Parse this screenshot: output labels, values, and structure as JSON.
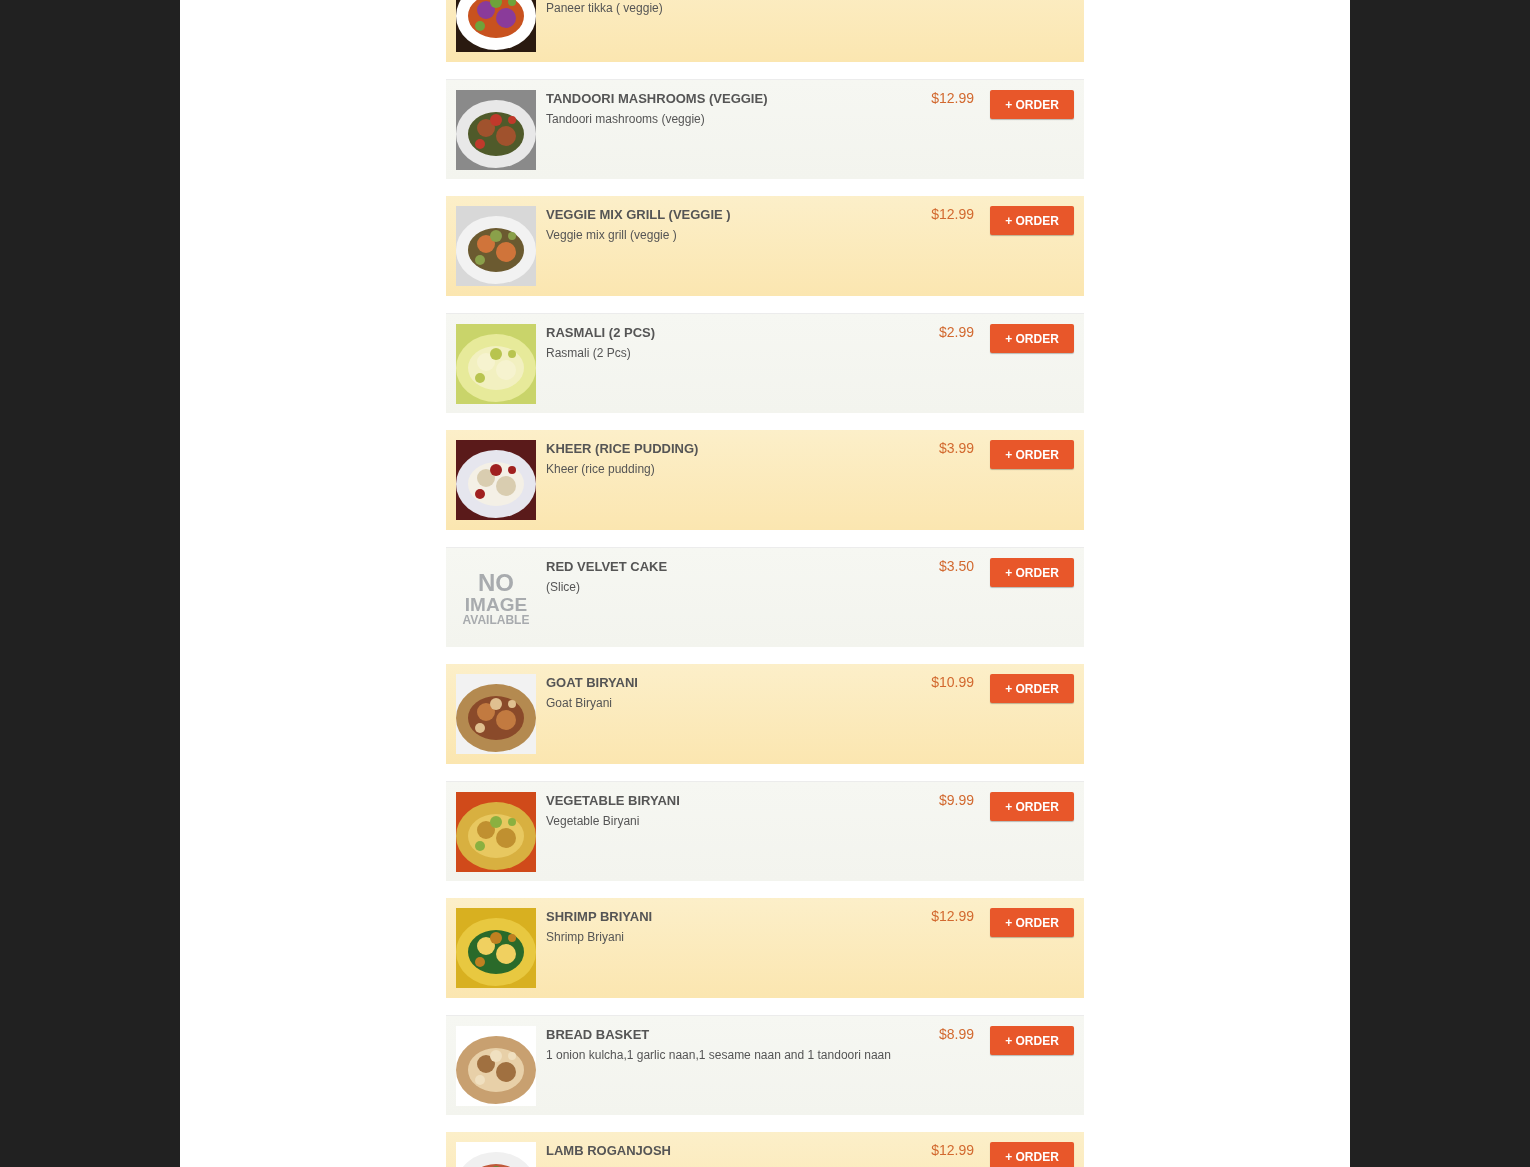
{
  "items": [
    {
      "description": "Paneer tikka ( veggie)"
    },
    {
      "name": "TANDOORI MASHROOMS (VEGGIE)",
      "description": "Tandoori mashrooms (veggie)",
      "price": "$12.99",
      "button": {
        "label": "+ ORDER"
      }
    },
    {
      "name": "VEGGIE MIX GRILL (VEGGIE )",
      "description": "Veggie mix grill (veggie )",
      "price": "$12.99",
      "button": {
        "label": "+ ORDER"
      }
    },
    {
      "name": "RASMALI (2 PCS)",
      "description": "Rasmali (2 Pcs)",
      "price": "$2.99",
      "button": {
        "label": "+ ORDER"
      }
    },
    {
      "name": "KHEER (RICE PUDDING)",
      "description": "Kheer (rice pudding)",
      "price": "$3.99",
      "button": {
        "label": "+ ORDER"
      }
    },
    {
      "image": {
        "kind": "placeholder",
        "lines": [
          "NO",
          "IMAGE",
          "AVAILABLE"
        ]
      },
      "name": "RED VELVET CAKE",
      "description": "(Slice)",
      "price": "$3.50",
      "button": {
        "label": "+ ORDER"
      }
    },
    {
      "name": "GOAT BIRYANI",
      "description": "Goat Biryani",
      "price": "$10.99",
      "button": {
        "label": "+ ORDER"
      }
    },
    {
      "name": "VEGETABLE BIRYANI",
      "description": "Vegetable Biryani",
      "price": "$9.99",
      "button": {
        "label": "+ ORDER"
      }
    },
    {
      "name": "SHRIMP BRIYANI",
      "description": "Shrimp Briyani",
      "price": "$12.99",
      "button": {
        "label": "+ ORDER"
      }
    },
    {
      "name": "BREAD BASKET",
      "description": "1 onion kulcha,1 garlic naan,1 sesame naan and 1 tandoori naan",
      "price": "$8.99",
      "button": {
        "label": "+ ORDER"
      }
    },
    {
      "name": "LAMB ROGANJOSH",
      "price": "$12.99",
      "button": {
        "label": "+ ORDER"
      }
    }
  ]
}
